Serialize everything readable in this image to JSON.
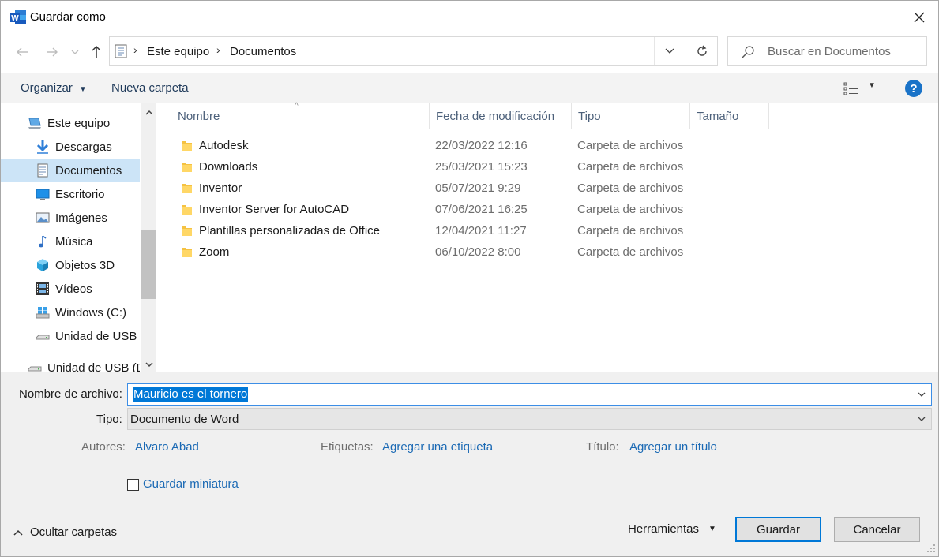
{
  "window": {
    "title": "Guardar como"
  },
  "address": {
    "segments": [
      "Este equipo",
      "Documentos"
    ]
  },
  "search": {
    "placeholder": "Buscar en Documentos"
  },
  "toolbar": {
    "organize": "Organizar",
    "new_folder": "Nueva carpeta"
  },
  "nav": {
    "items": [
      {
        "label": "Este equipo",
        "icon": "computer-icon"
      },
      {
        "label": "Descargas",
        "icon": "download-arrow-icon"
      },
      {
        "label": "Documentos",
        "icon": "document-icon",
        "selected": true
      },
      {
        "label": "Escritorio",
        "icon": "desktop-icon"
      },
      {
        "label": "Imágenes",
        "icon": "pictures-icon"
      },
      {
        "label": "Música",
        "icon": "music-note-icon"
      },
      {
        "label": "Objetos 3D",
        "icon": "cube-3d-icon"
      },
      {
        "label": "Vídeos",
        "icon": "film-icon"
      },
      {
        "label": "Windows  (C:)",
        "icon": "windows-drive-icon"
      },
      {
        "label": "Unidad de USB (",
        "icon": "usb-drive-icon"
      },
      {
        "label": "Unidad de USB (D",
        "icon": "usb-drive-icon"
      }
    ]
  },
  "columns": {
    "name": "Nombre",
    "date": "Fecha de modificación",
    "type": "Tipo",
    "size": "Tamaño"
  },
  "files": [
    {
      "name": "Autodesk",
      "date": "22/03/2022 12:16",
      "type": "Carpeta de archivos"
    },
    {
      "name": "Downloads",
      "date": "25/03/2021 15:23",
      "type": "Carpeta de archivos"
    },
    {
      "name": "Inventor",
      "date": "05/07/2021 9:29",
      "type": "Carpeta de archivos"
    },
    {
      "name": "Inventor Server for AutoCAD",
      "date": "07/06/2021 16:25",
      "type": "Carpeta de archivos"
    },
    {
      "name": "Plantillas personalizadas de Office",
      "date": "12/04/2021 11:27",
      "type": "Carpeta de archivos"
    },
    {
      "name": "Zoom",
      "date": "06/10/2022 8:00",
      "type": "Carpeta de archivos"
    }
  ],
  "form": {
    "filename_label": "Nombre de archivo:",
    "filename_value": "Mauricio es el tornero",
    "type_label": "Tipo:",
    "type_value": "Documento de Word",
    "authors_label": "Autores:",
    "authors_value": "Alvaro Abad",
    "tags_label": "Etiquetas:",
    "tags_value": "Agregar una etiqueta",
    "title_label": "Título:",
    "title_value": "Agregar un título",
    "thumbnail_label": "Guardar miniatura"
  },
  "footer": {
    "hide_folders": "Ocultar carpetas",
    "tools": "Herramientas",
    "save": "Guardar",
    "cancel": "Cancelar"
  },
  "colors": {
    "accent": "#0078d7",
    "link": "#1a69b4",
    "selected_nav": "#cce4f7",
    "folder": "#f5c242"
  }
}
